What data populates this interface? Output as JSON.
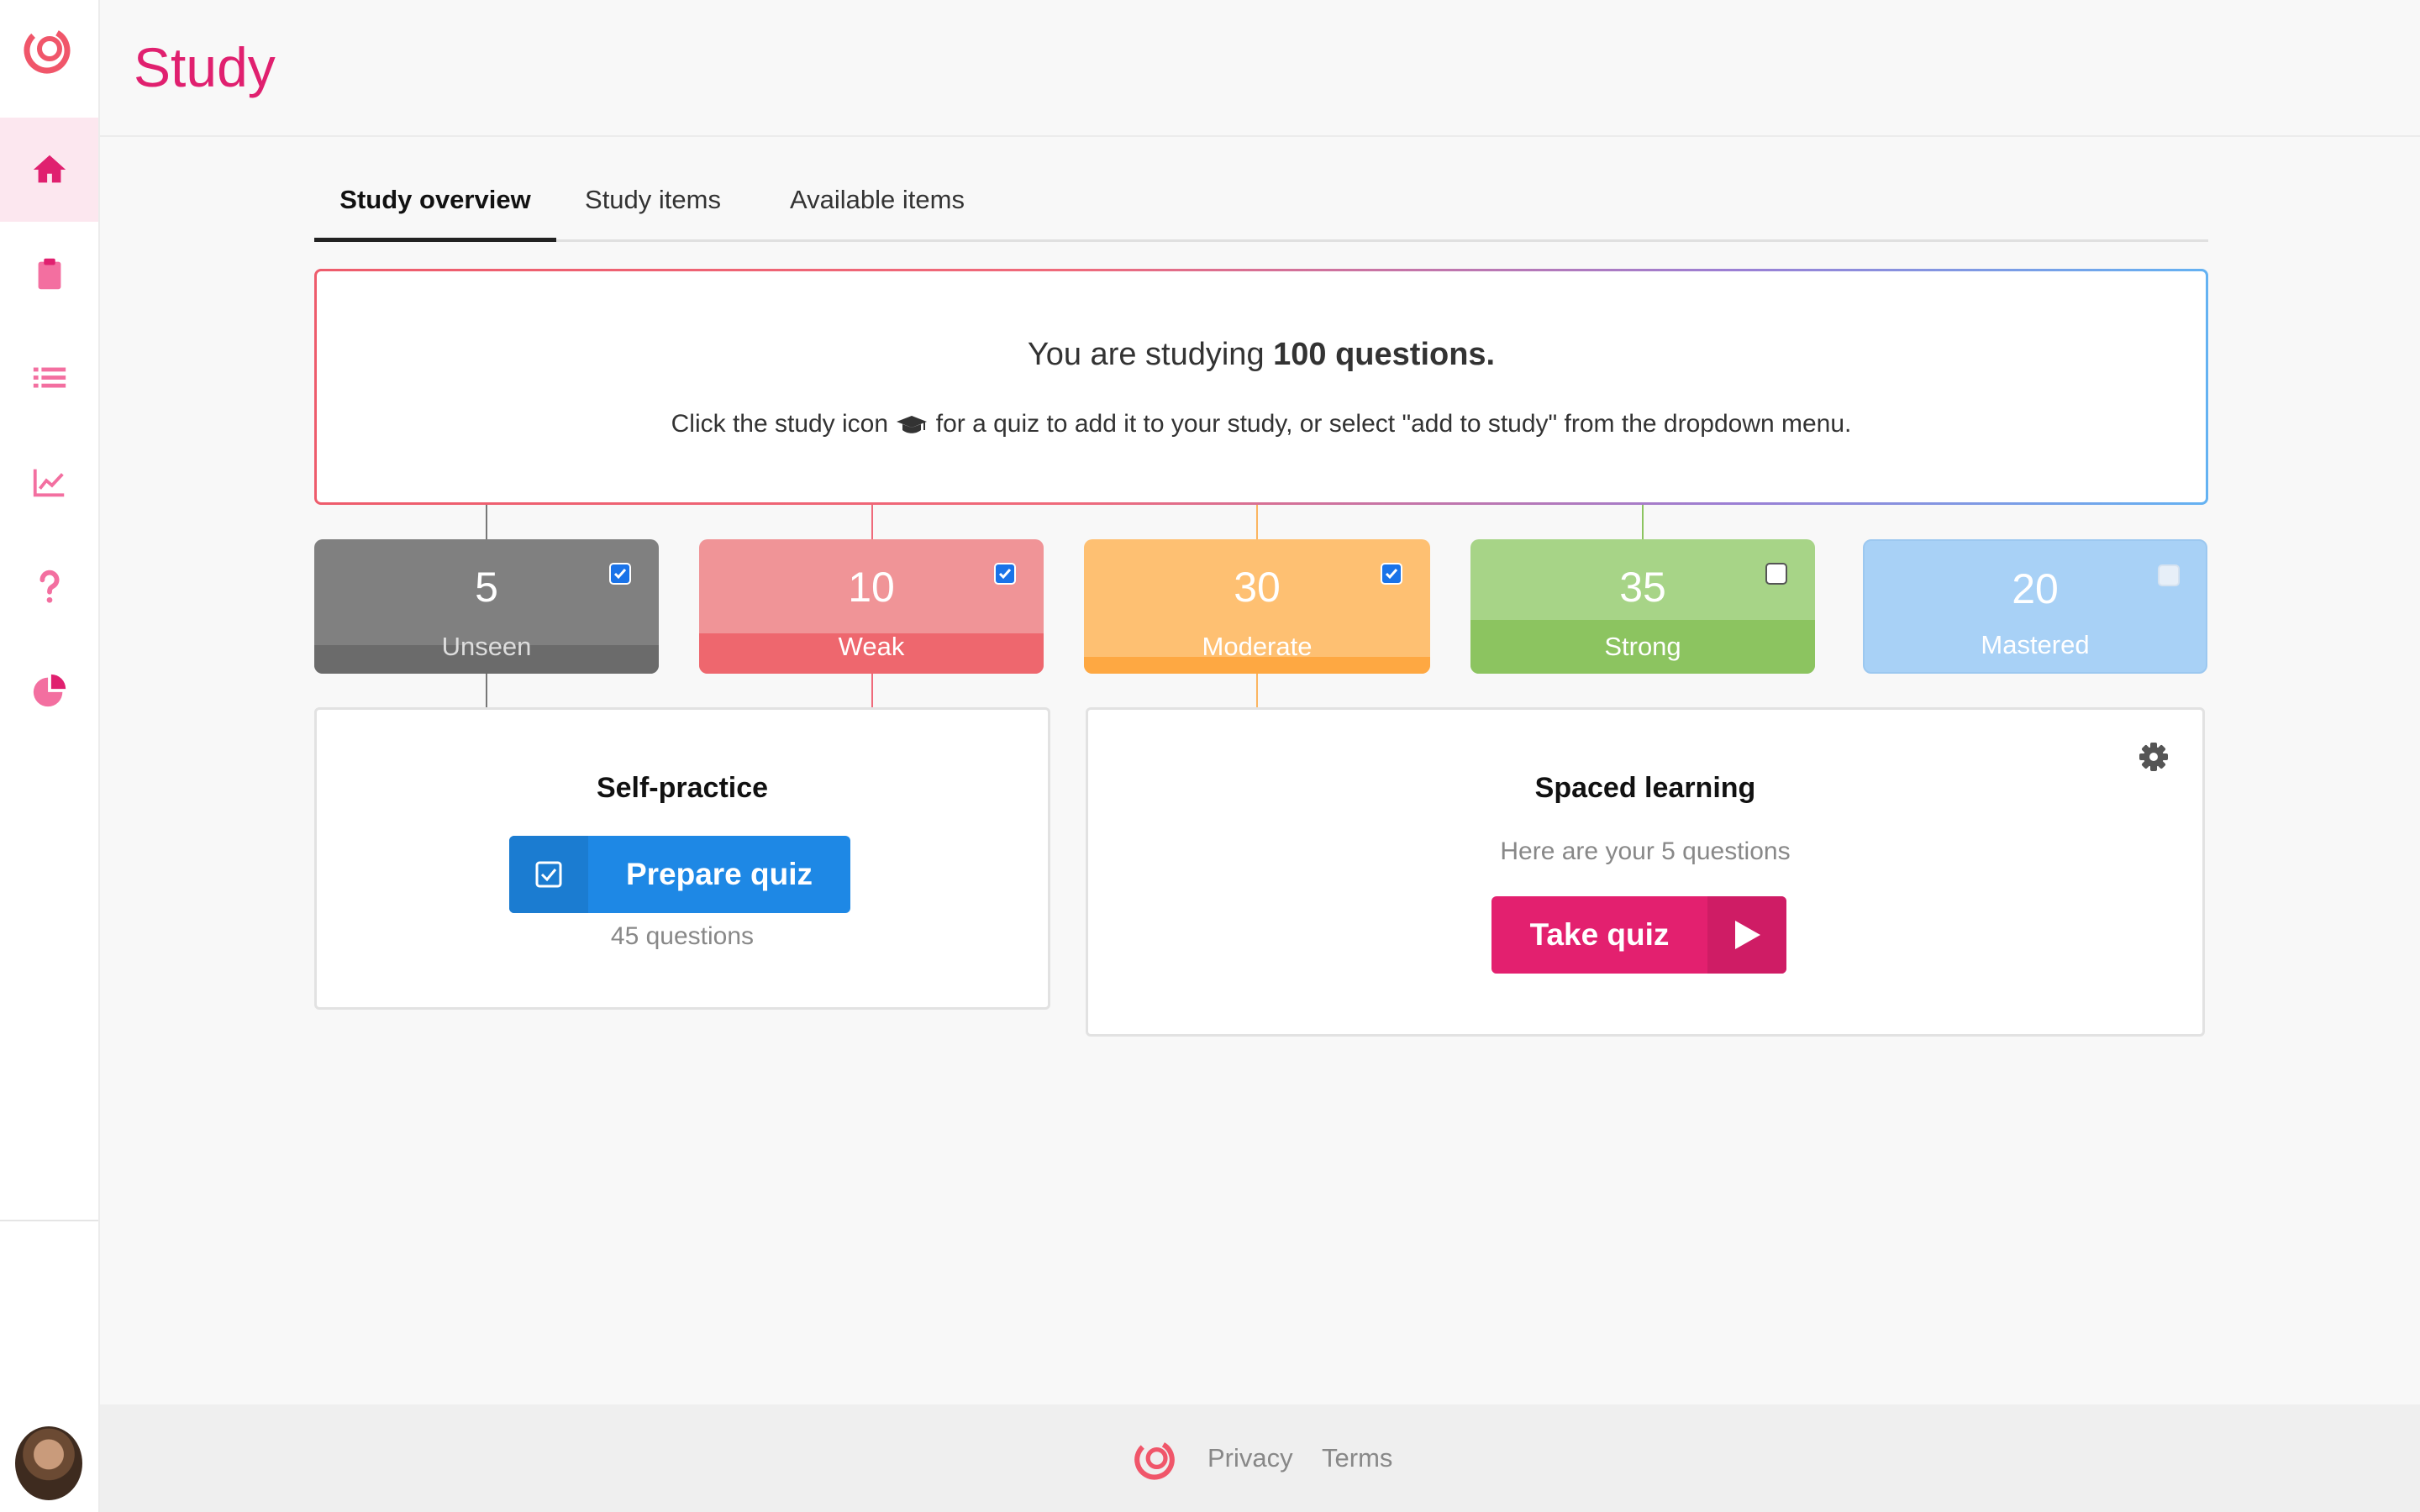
{
  "app": {
    "page_title": "Study"
  },
  "sidebar": {
    "items": [
      {
        "name": "home",
        "icon": "home-icon",
        "active": true
      },
      {
        "name": "clipboard",
        "icon": "clipboard-icon",
        "active": false
      },
      {
        "name": "list",
        "icon": "list-icon",
        "active": false
      },
      {
        "name": "analytics",
        "icon": "chart-line-icon",
        "active": false
      },
      {
        "name": "help",
        "icon": "question-icon",
        "active": false
      },
      {
        "name": "reports",
        "icon": "pie-chart-icon",
        "active": false
      }
    ],
    "accent": "#e0206f"
  },
  "tabs": [
    {
      "label": "Study overview",
      "active": true
    },
    {
      "label": "Study items",
      "active": false
    },
    {
      "label": "Available items",
      "active": false
    }
  ],
  "info": {
    "prefix": "You are studying ",
    "count_text": "100 questions.",
    "hint_before": "Click the study icon ",
    "hint_after": " for a quiz to add it to your study, or select \"add to study\" from the dropdown menu."
  },
  "categories": [
    {
      "count": "5",
      "label": "Unseen",
      "checked": true,
      "color": "#808080",
      "band": "#6b6b6b"
    },
    {
      "count": "10",
      "label": "Weak",
      "checked": true,
      "color": "#f09497",
      "band": "#ee676e"
    },
    {
      "count": "30",
      "label": "Moderate",
      "checked": true,
      "color": "#fec072",
      "band": "#fea842"
    },
    {
      "count": "35",
      "label": "Strong",
      "checked": false,
      "color": "#a7d487",
      "band": "#8cc460"
    },
    {
      "count": "20",
      "label": "Mastered",
      "checked": false,
      "disabled": true,
      "color": "#a8d1f6",
      "band": "#a8d1f6"
    }
  ],
  "self_practice": {
    "title": "Self-practice",
    "button_label": "Prepare quiz",
    "button_icon": "checkbox-icon",
    "questions_text": "45 questions"
  },
  "spaced_learning": {
    "title": "Spaced learning",
    "subtitle": "Here are your 5 questions",
    "button_label": "Take quiz",
    "button_icon": "play-icon",
    "settings_icon": "gear-icon"
  },
  "footer": {
    "links": [
      "Privacy",
      "Terms"
    ]
  }
}
